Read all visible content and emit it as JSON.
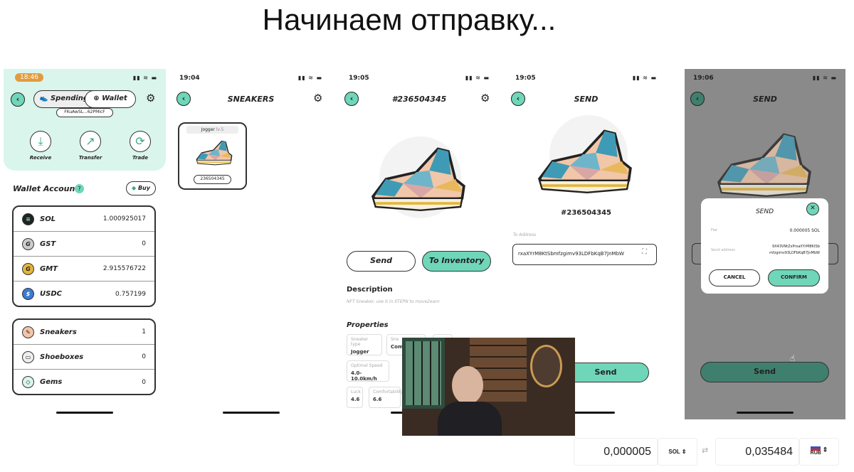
{
  "slide_title": "Начинаем отправку...",
  "screen1": {
    "time": "18:46",
    "tab_spending": "Spending",
    "tab_wallet": "Wallet",
    "address": "FKuAwSL...62PMicF",
    "actions": [
      {
        "label": "Receive",
        "icon": "download-icon"
      },
      {
        "label": "Transfer",
        "icon": "arrow-up-right-icon"
      },
      {
        "label": "Trade",
        "icon": "swap-icon"
      }
    ],
    "wallet_account": "Wallet Account",
    "buy": "Buy",
    "tokens": [
      {
        "name": "SOL",
        "value": "1.000925017"
      },
      {
        "name": "GST",
        "value": "0"
      },
      {
        "name": "GMT",
        "value": "2.915576722"
      },
      {
        "name": "USDC",
        "value": "0.757199"
      }
    ],
    "assets": [
      {
        "name": "Sneakers",
        "value": "1"
      },
      {
        "name": "Shoeboxes",
        "value": "0"
      },
      {
        "name": "Gems",
        "value": "0"
      }
    ]
  },
  "screen2": {
    "time": "19:04",
    "title": "SNEAKERS",
    "card_type": "Jogger",
    "card_level": "lv.5",
    "card_id": "236504345"
  },
  "screen3": {
    "time": "19:05",
    "title": "#236504345",
    "send": "Send",
    "to_inventory": "To Inventory",
    "description_h": "Description",
    "description": "NFT Sneaker, use it in STEPN to move2earn",
    "properties_h": "Properties",
    "properties": [
      {
        "label": "Sneaker type",
        "value": "Jogger"
      },
      {
        "label": "Sne",
        "value": "Com"
      },
      {
        "label": "Optimal Speed",
        "value": "4.0-10.0km/h"
      },
      {
        "label": "Luck",
        "value": "4.6"
      },
      {
        "label": "Comfortability",
        "value": "6.6"
      }
    ]
  },
  "screen4": {
    "time": "19:05",
    "title": "SEND",
    "sneaker_id": "#236504345",
    "to_address_label": "To Address",
    "to_address": "rxaXYrM8KtSbmfzgimv93LDFbKqB7JnMbW",
    "send": "Send"
  },
  "screen5": {
    "time": "19:06",
    "title": "SEND",
    "send": "Send",
    "dialog": {
      "title": "SEND",
      "fee_label": "Fee",
      "fee": "0.000005 SOL",
      "address_label": "Send address",
      "address_1": "9X43VNtZxPrxaXYrM8KtSb",
      "address_2": "mfzgimv93LDFbKqB7JnMbW",
      "cancel": "CANCEL",
      "confirm": "CONFIRM"
    }
  },
  "converter": {
    "amount": "0,000005",
    "from": "SOL",
    "result": "0,035484",
    "to": "RUB"
  },
  "colors": {
    "accent": "#6fd6b9",
    "dim_button": "#3f7f6e",
    "overlay": "#8a8a8a"
  }
}
